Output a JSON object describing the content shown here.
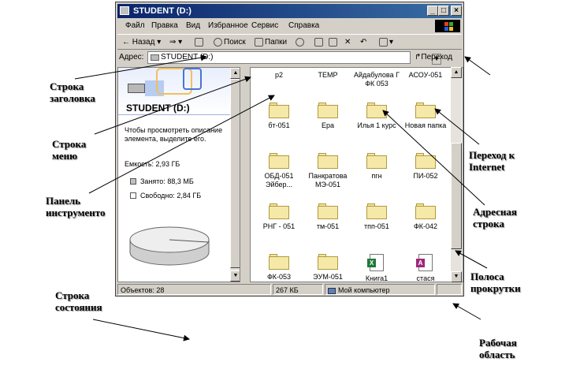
{
  "window": {
    "title": "STUDENT (D:)",
    "controls": {
      "minimize": "_",
      "maximize": "□",
      "close": "×"
    }
  },
  "menu": [
    "Файл",
    "Правка",
    "Вид",
    "Избранное",
    "Сервис",
    "Справка"
  ],
  "toolbar": {
    "back": "Назад",
    "search": "Поиск",
    "folders": "Папки"
  },
  "address": {
    "label": "Адрес:",
    "value": "STUDENT (D:)",
    "go": "Переход"
  },
  "left_panel": {
    "title": "STUDENT (D:)",
    "description": "Чтобы просмотреть описание элемента, выделите его.",
    "capacity": "Емкость: 2,93 ГБ",
    "used": "Занято: 88,3 МБ",
    "free": "Свободно: 2,84 ГБ",
    "used_fraction": 0.03
  },
  "items": [
    {
      "name": "p2",
      "type": "folder"
    },
    {
      "name": "TEMP",
      "type": "folder"
    },
    {
      "name": "Айдабулова Г ФК 053",
      "type": "folder"
    },
    {
      "name": "АСОУ-051",
      "type": "folder"
    },
    {
      "name": "бт-051",
      "type": "folder"
    },
    {
      "name": "Ера",
      "type": "folder"
    },
    {
      "name": "Илья 1 курс",
      "type": "folder"
    },
    {
      "name": "Новая папка",
      "type": "folder"
    },
    {
      "name": "ОБД-051 Эйбер...",
      "type": "folder"
    },
    {
      "name": "Панкратова МЭ-051",
      "type": "folder"
    },
    {
      "name": "пгн",
      "type": "folder"
    },
    {
      "name": "ПИ-052",
      "type": "folder"
    },
    {
      "name": "РНГ - 051",
      "type": "folder"
    },
    {
      "name": "тм-051",
      "type": "folder"
    },
    {
      "name": "тпп-051",
      "type": "folder"
    },
    {
      "name": "ФК-042",
      "type": "folder"
    },
    {
      "name": "ФК-053",
      "type": "folder"
    },
    {
      "name": "ЭУМ-051",
      "type": "folder"
    },
    {
      "name": "Книга1",
      "type": "excel"
    },
    {
      "name": "стася",
      "type": "access"
    }
  ],
  "status": {
    "objects": "Объектов: 28",
    "size": "267 КБ",
    "location": "Мой компьютер"
  },
  "annotations": {
    "title_bar": "Строка заголовка",
    "menu_bar": "Строка меню",
    "toolbar": "Панель инструменто",
    "status_bar": "Строка состояния",
    "internet": "Переход к Internet",
    "address_bar": "Адресная строка",
    "scrollbar": "Полоса прокрутки",
    "work_area": "Рабочая область"
  },
  "colors": {
    "title_start": "#0a246a",
    "title_end": "#3a6ea5",
    "chrome": "#d4d0c8",
    "folder": "#f6e8a6",
    "excel": "#1e7a3a",
    "access": "#a0287a"
  }
}
